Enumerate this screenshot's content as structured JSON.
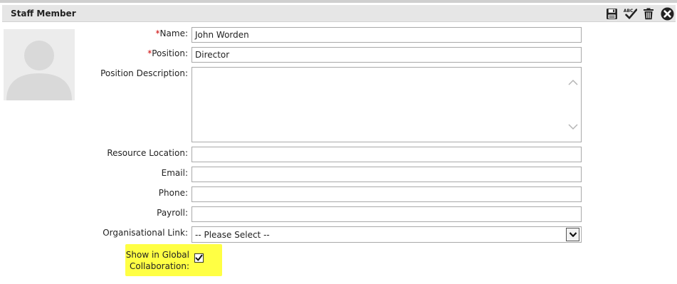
{
  "header": {
    "title": "Staff Member",
    "icons": [
      "save-icon",
      "spellcheck-icon",
      "delete-icon",
      "close-icon"
    ]
  },
  "form": {
    "required_mark": "*",
    "name": {
      "label": "Name:",
      "value": "John Worden"
    },
    "position": {
      "label": "Position:",
      "value": "Director"
    },
    "position_description": {
      "label": "Position Description:",
      "value": ""
    },
    "resource_location": {
      "label": "Resource Location:",
      "value": ""
    },
    "email": {
      "label": "Email:",
      "value": ""
    },
    "phone": {
      "label": "Phone:",
      "value": ""
    },
    "payroll": {
      "label": "Payroll:",
      "value": ""
    },
    "organisational_link": {
      "label": "Organisational Link:",
      "selected": "-- Please Select --"
    },
    "global_collaboration": {
      "label_line1": "Show in Global",
      "label_line2": "Collaboration:",
      "checked": true
    }
  },
  "colors": {
    "header_bg": "#e6e6e6",
    "required": "#cc0000",
    "highlight": "#ffff44",
    "field_border": "#a9a9a9"
  }
}
